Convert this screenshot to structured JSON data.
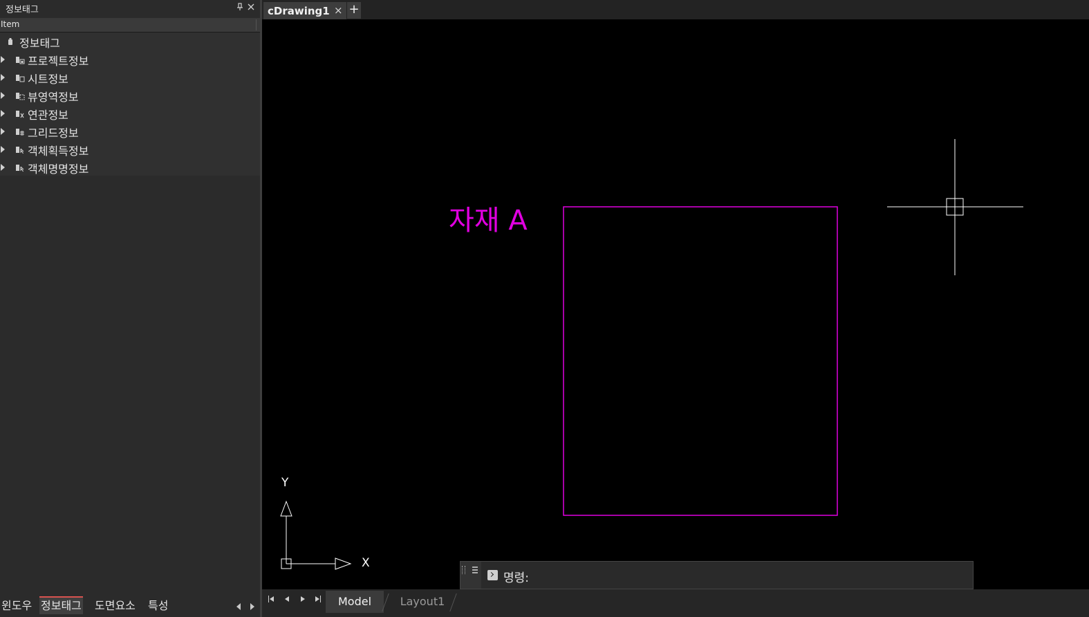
{
  "left_panel": {
    "title": "정보태그",
    "pin_icon": "pin-icon",
    "close_icon": "close-icon",
    "column_header": "Item",
    "root_label": "정보태그",
    "items": [
      {
        "label": "프로젝트정보",
        "icon": "project-info-icon"
      },
      {
        "label": "시트정보",
        "icon": "sheet-info-icon"
      },
      {
        "label": "뷰영역정보",
        "icon": "view-area-info-icon"
      },
      {
        "label": "연관정보",
        "icon": "relation-info-icon"
      },
      {
        "label": "그리드정보",
        "icon": "grid-info-icon"
      },
      {
        "label": "객체획득정보",
        "icon": "object-acquire-info-icon"
      },
      {
        "label": "객체명명정보",
        "icon": "object-naming-info-icon"
      }
    ],
    "bottom_tabs": [
      "윈도우",
      "정보태그",
      "도면요소",
      "특성"
    ],
    "active_bottom_tab": "정보태그"
  },
  "document_tabs": {
    "tabs": [
      {
        "label": "cDrawing1",
        "close": "×"
      }
    ],
    "add_label": "+"
  },
  "canvas": {
    "background": "#000000",
    "entity_color": "#e000e0",
    "text_entity": "자재 A",
    "ucs_x_label": "X",
    "ucs_y_label": "Y"
  },
  "command_bar": {
    "menu_icon": "menu-icon",
    "prompt_icon": "terminal-icon",
    "prompt_label": "명령:"
  },
  "layout_tabs": {
    "tabs": [
      "Model",
      "Layout1"
    ],
    "active": "Model"
  }
}
